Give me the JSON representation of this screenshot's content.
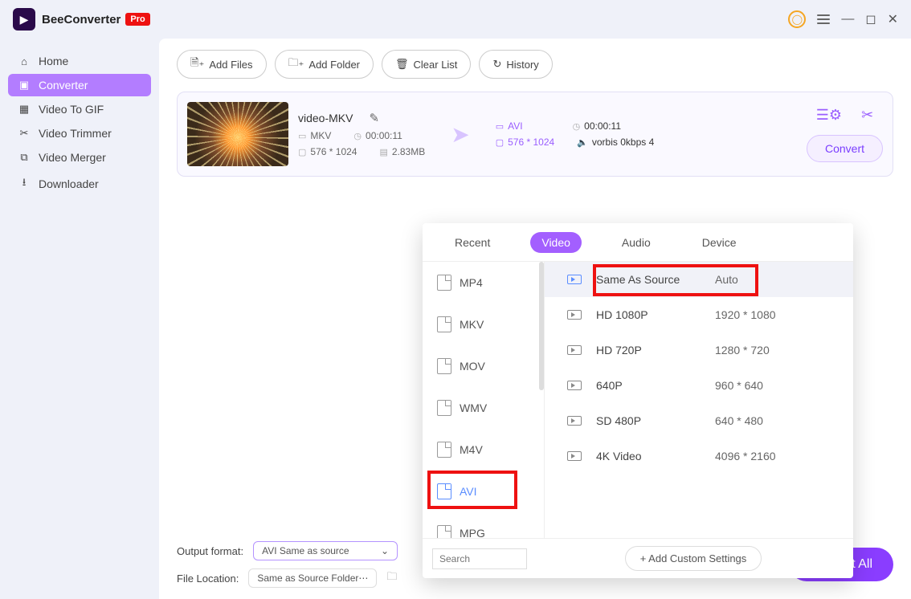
{
  "app": {
    "name": "BeeConverter",
    "badge": "Pro"
  },
  "sidebar": {
    "items": [
      {
        "label": "Home",
        "icon": "⌂"
      },
      {
        "label": "Converter",
        "icon": "▣"
      },
      {
        "label": "Video To GIF",
        "icon": "▦"
      },
      {
        "label": "Video Trimmer",
        "icon": "✂"
      },
      {
        "label": "Video Merger",
        "icon": "⧉"
      },
      {
        "label": "Downloader",
        "icon": "⭳"
      }
    ]
  },
  "toolbar": {
    "add_files": "Add Files",
    "add_folder": "Add Folder",
    "clear_list": "Clear List",
    "history": "History"
  },
  "file": {
    "title": "video-MKV",
    "src_format": "MKV",
    "src_duration": "00:00:11",
    "src_res": "576 * 1024",
    "src_size": "2.83MB",
    "out_format": "AVI",
    "out_duration": "00:00:11",
    "out_res": "576 * 1024",
    "out_audio": "vorbis 0kbps 4",
    "convert": "Convert"
  },
  "dropdown": {
    "tabs": {
      "recent": "Recent",
      "video": "Video",
      "audio": "Audio",
      "device": "Device"
    },
    "formats": [
      "MP4",
      "MKV",
      "MOV",
      "WMV",
      "M4V",
      "AVI",
      "MPG"
    ],
    "selected_format_index": 5,
    "resolutions": [
      {
        "name": "Same As Source",
        "dim": "Auto"
      },
      {
        "name": "HD 1080P",
        "dim": "1920 * 1080"
      },
      {
        "name": "HD 720P",
        "dim": "1280 * 720"
      },
      {
        "name": "640P",
        "dim": "960 * 640"
      },
      {
        "name": "SD 480P",
        "dim": "640 * 480"
      },
      {
        "name": "4K Video",
        "dim": "4096 * 2160"
      }
    ],
    "search_placeholder": "Search",
    "add_custom": "+ Add Custom Settings"
  },
  "footer": {
    "output_label": "Output format:",
    "output_value": "AVI Same as source",
    "location_label": "File Location:",
    "location_value": "Same as Source Folder",
    "convert_all": "Convert All"
  }
}
